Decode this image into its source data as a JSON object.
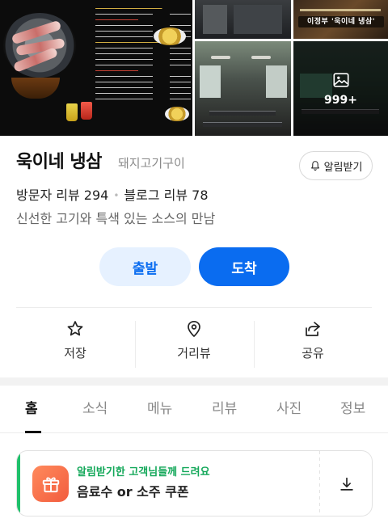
{
  "gallery": {
    "photo_labels": {
      "banner": "이정부 '욱이네 냉삼'"
    },
    "more_count": "999+"
  },
  "place": {
    "name": "욱이네 냉삼",
    "category": "돼지고기구이",
    "notify_label": "알림받기",
    "visitor_review_label": "방문자 리뷰 294",
    "blog_review_label": "블로그 리뷰 78",
    "description": "신선한 고기와 특색 있는 소스의 만남"
  },
  "actions": {
    "depart": "출발",
    "arrive": "도착"
  },
  "quick_actions": [
    {
      "label": "저장",
      "icon": "star-icon"
    },
    {
      "label": "거리뷰",
      "icon": "location-pin-icon"
    },
    {
      "label": "공유",
      "icon": "share-icon"
    }
  ],
  "tabs": [
    {
      "label": "홈",
      "active": true
    },
    {
      "label": "소식",
      "active": false
    },
    {
      "label": "메뉴",
      "active": false
    },
    {
      "label": "리뷰",
      "active": false
    },
    {
      "label": "사진",
      "active": false
    },
    {
      "label": "정보",
      "active": false
    }
  ],
  "coupon": {
    "subtitle": "알림받기한 고객님들께 드려요",
    "title": "음료수 or 소주 쿠폰",
    "icon": "gift-icon",
    "download_icon": "download-icon"
  },
  "colors": {
    "primary": "#0a6cf0",
    "primary_light": "#e6f1ff",
    "coupon_green": "#14a85a",
    "gift_orange": "#f25c3e"
  }
}
